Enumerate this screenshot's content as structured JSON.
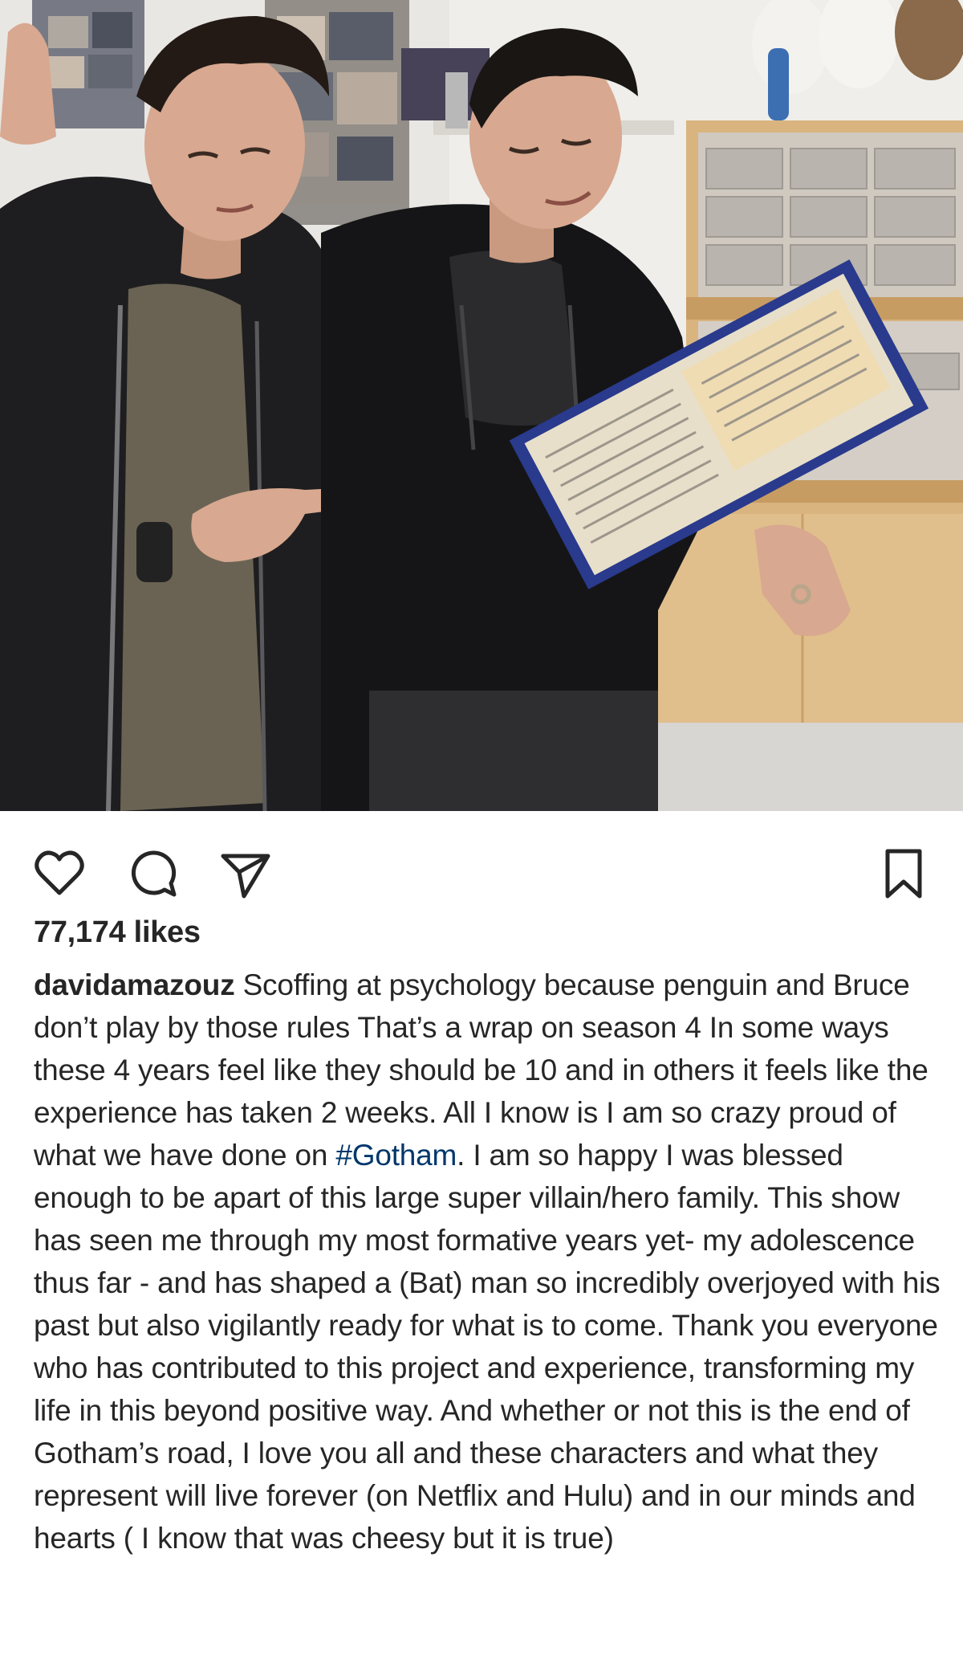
{
  "post": {
    "photo": {
      "alt": "",
      "colors": {
        "wall": "#e9e7e3",
        "shelf_wood": "#d9b47f",
        "jacket": "#1e1e20",
        "hoodie": "#151517",
        "skin": "#d8a890",
        "hair": "#231a15",
        "book_cover": "#2a3a8c",
        "book_page": "#e7dfca"
      }
    },
    "actions": {
      "like_icon": "heart-outline-icon",
      "comment_icon": "speech-bubble-icon",
      "share_icon": "paper-plane-icon",
      "save_icon": "bookmark-outline-icon"
    },
    "likes_text": "77,174 likes",
    "caption": {
      "username": "davidamazouz",
      "text_before_hashtag": " Scoffing at psychology because penguin and Bruce don’t play by those rules  That’s a wrap on season 4  In some ways these 4 years feel like they should be 10 and in others it feels like the experience has taken 2 weeks. All I know is I am so crazy proud of what we have done on ",
      "hashtag": "#Gotham",
      "text_after_hashtag": ". I am so happy I was blessed enough to be apart of this large super villain/hero family. This show has seen me through my most formative years yet- my adolescence thus far - and has shaped a (Bat) man so incredibly overjoyed with his past but also vigilantly ready for what is to come. Thank you everyone who has contributed to this project and experience, transforming my life in this beyond positive way. And whether or not this is the end of Gotham’s road, I love you all and these characters and what they represent will live forever (on Netflix and Hulu) and in our minds and hearts ( I know that was cheesy but it is true)"
    },
    "theme": {
      "text": "#262626",
      "hashtag": "#00376b",
      "background": "#ffffff"
    }
  }
}
